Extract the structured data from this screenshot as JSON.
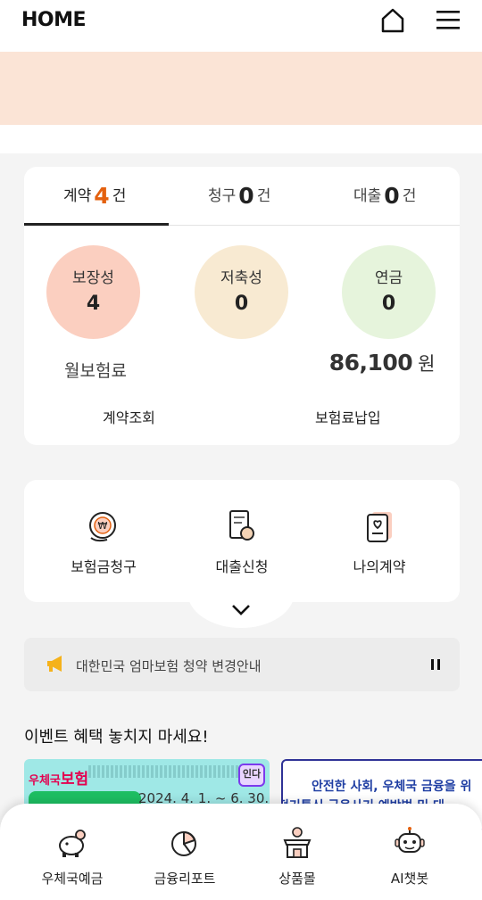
{
  "header": {
    "title": "HOME"
  },
  "summary": {
    "tabs": [
      {
        "label": "계약",
        "count": "4",
        "unit": "건",
        "active": true
      },
      {
        "label": "청구",
        "count": "0",
        "unit": "건",
        "active": false
      },
      {
        "label": "대출",
        "count": "0",
        "unit": "건",
        "active": false
      }
    ],
    "categories": [
      {
        "label": "보장성",
        "value": "4",
        "color": "#fbcfc0"
      },
      {
        "label": "저축성",
        "value": "0",
        "color": "#f8ead2"
      },
      {
        "label": "연금",
        "value": "0",
        "color": "#e6f4dc"
      }
    ],
    "monthly_premium_label": "월보험료",
    "monthly_premium_value": "86,100",
    "monthly_premium_unit": "원",
    "link_contract": "계약조회",
    "link_payment": "보험료납입"
  },
  "quick_actions": [
    {
      "label": "보험금청구",
      "icon": "claim-coin-icon"
    },
    {
      "label": "대출신청",
      "icon": "loan-document-icon"
    },
    {
      "label": "나의계약",
      "icon": "my-contract-icon"
    }
  ],
  "notice": {
    "text": "대한민국 엄마보험 청약 변경안내"
  },
  "events": {
    "title": "이벤트 혜택 놓치지 마세요!",
    "banner1": {
      "brand_prefix": "우체국",
      "brand_main": "보험",
      "dates": "2024. 4. 1. ~ 6. 30.",
      "sticker": "인다"
    },
    "banner2": {
      "line1": "안전한 사회, 우체국 금융을 위",
      "line2": "전기통신 금융사기 예방법 및 대"
    }
  },
  "bottom_nav": [
    {
      "label": "우체국예금",
      "icon": "piggy-bank-icon"
    },
    {
      "label": "금융리포트",
      "icon": "pie-chart-icon"
    },
    {
      "label": "상품몰",
      "icon": "shop-icon"
    },
    {
      "label": "AI챗봇",
      "icon": "robot-icon"
    }
  ],
  "colors": {
    "accent": "#e4610f",
    "banner_bg": "#fbe4d6",
    "page_bg": "#f4f4f4"
  }
}
